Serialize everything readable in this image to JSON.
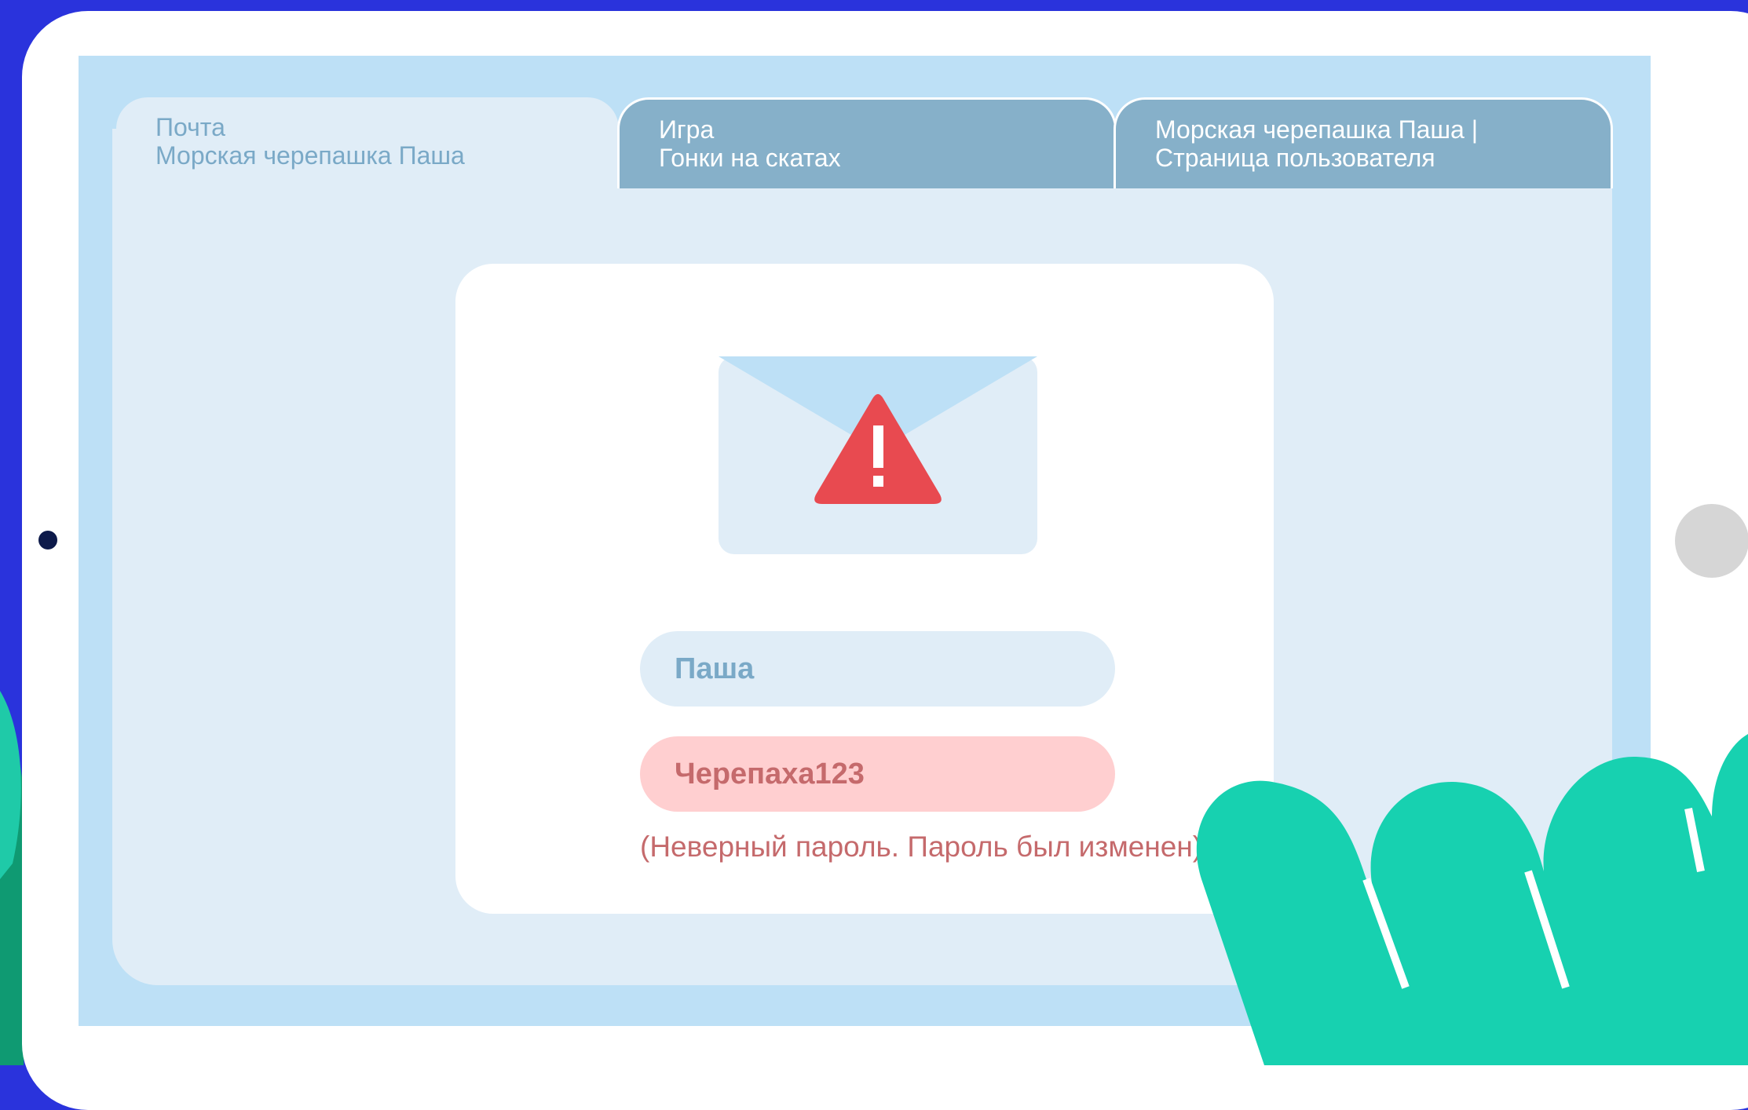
{
  "browser": {
    "tabs": [
      {
        "line1": "Почта",
        "line2": "Морская черепашка Паша",
        "active": true
      },
      {
        "line1": "Игра",
        "line2": "Гонки на скатах",
        "active": false
      },
      {
        "line1": "Морская черепашка Паша |",
        "line2": "Страница пользователя",
        "active": false
      }
    ]
  },
  "login": {
    "icon": "envelope-warning-icon",
    "username_value": "Паша",
    "password_value": "Черепаха123",
    "error_text": "(Неверный пароль. Пароль был изменен)"
  },
  "colors": {
    "background": "#2a33dc",
    "screen": "#bde0f6",
    "page": "#e0edf7",
    "tab_inactive": "#86b0c9",
    "warning_red": "#e84a50",
    "error_text": "#c56a6c",
    "password_field": "#ffcfd0",
    "hand": "#17d1b0"
  }
}
